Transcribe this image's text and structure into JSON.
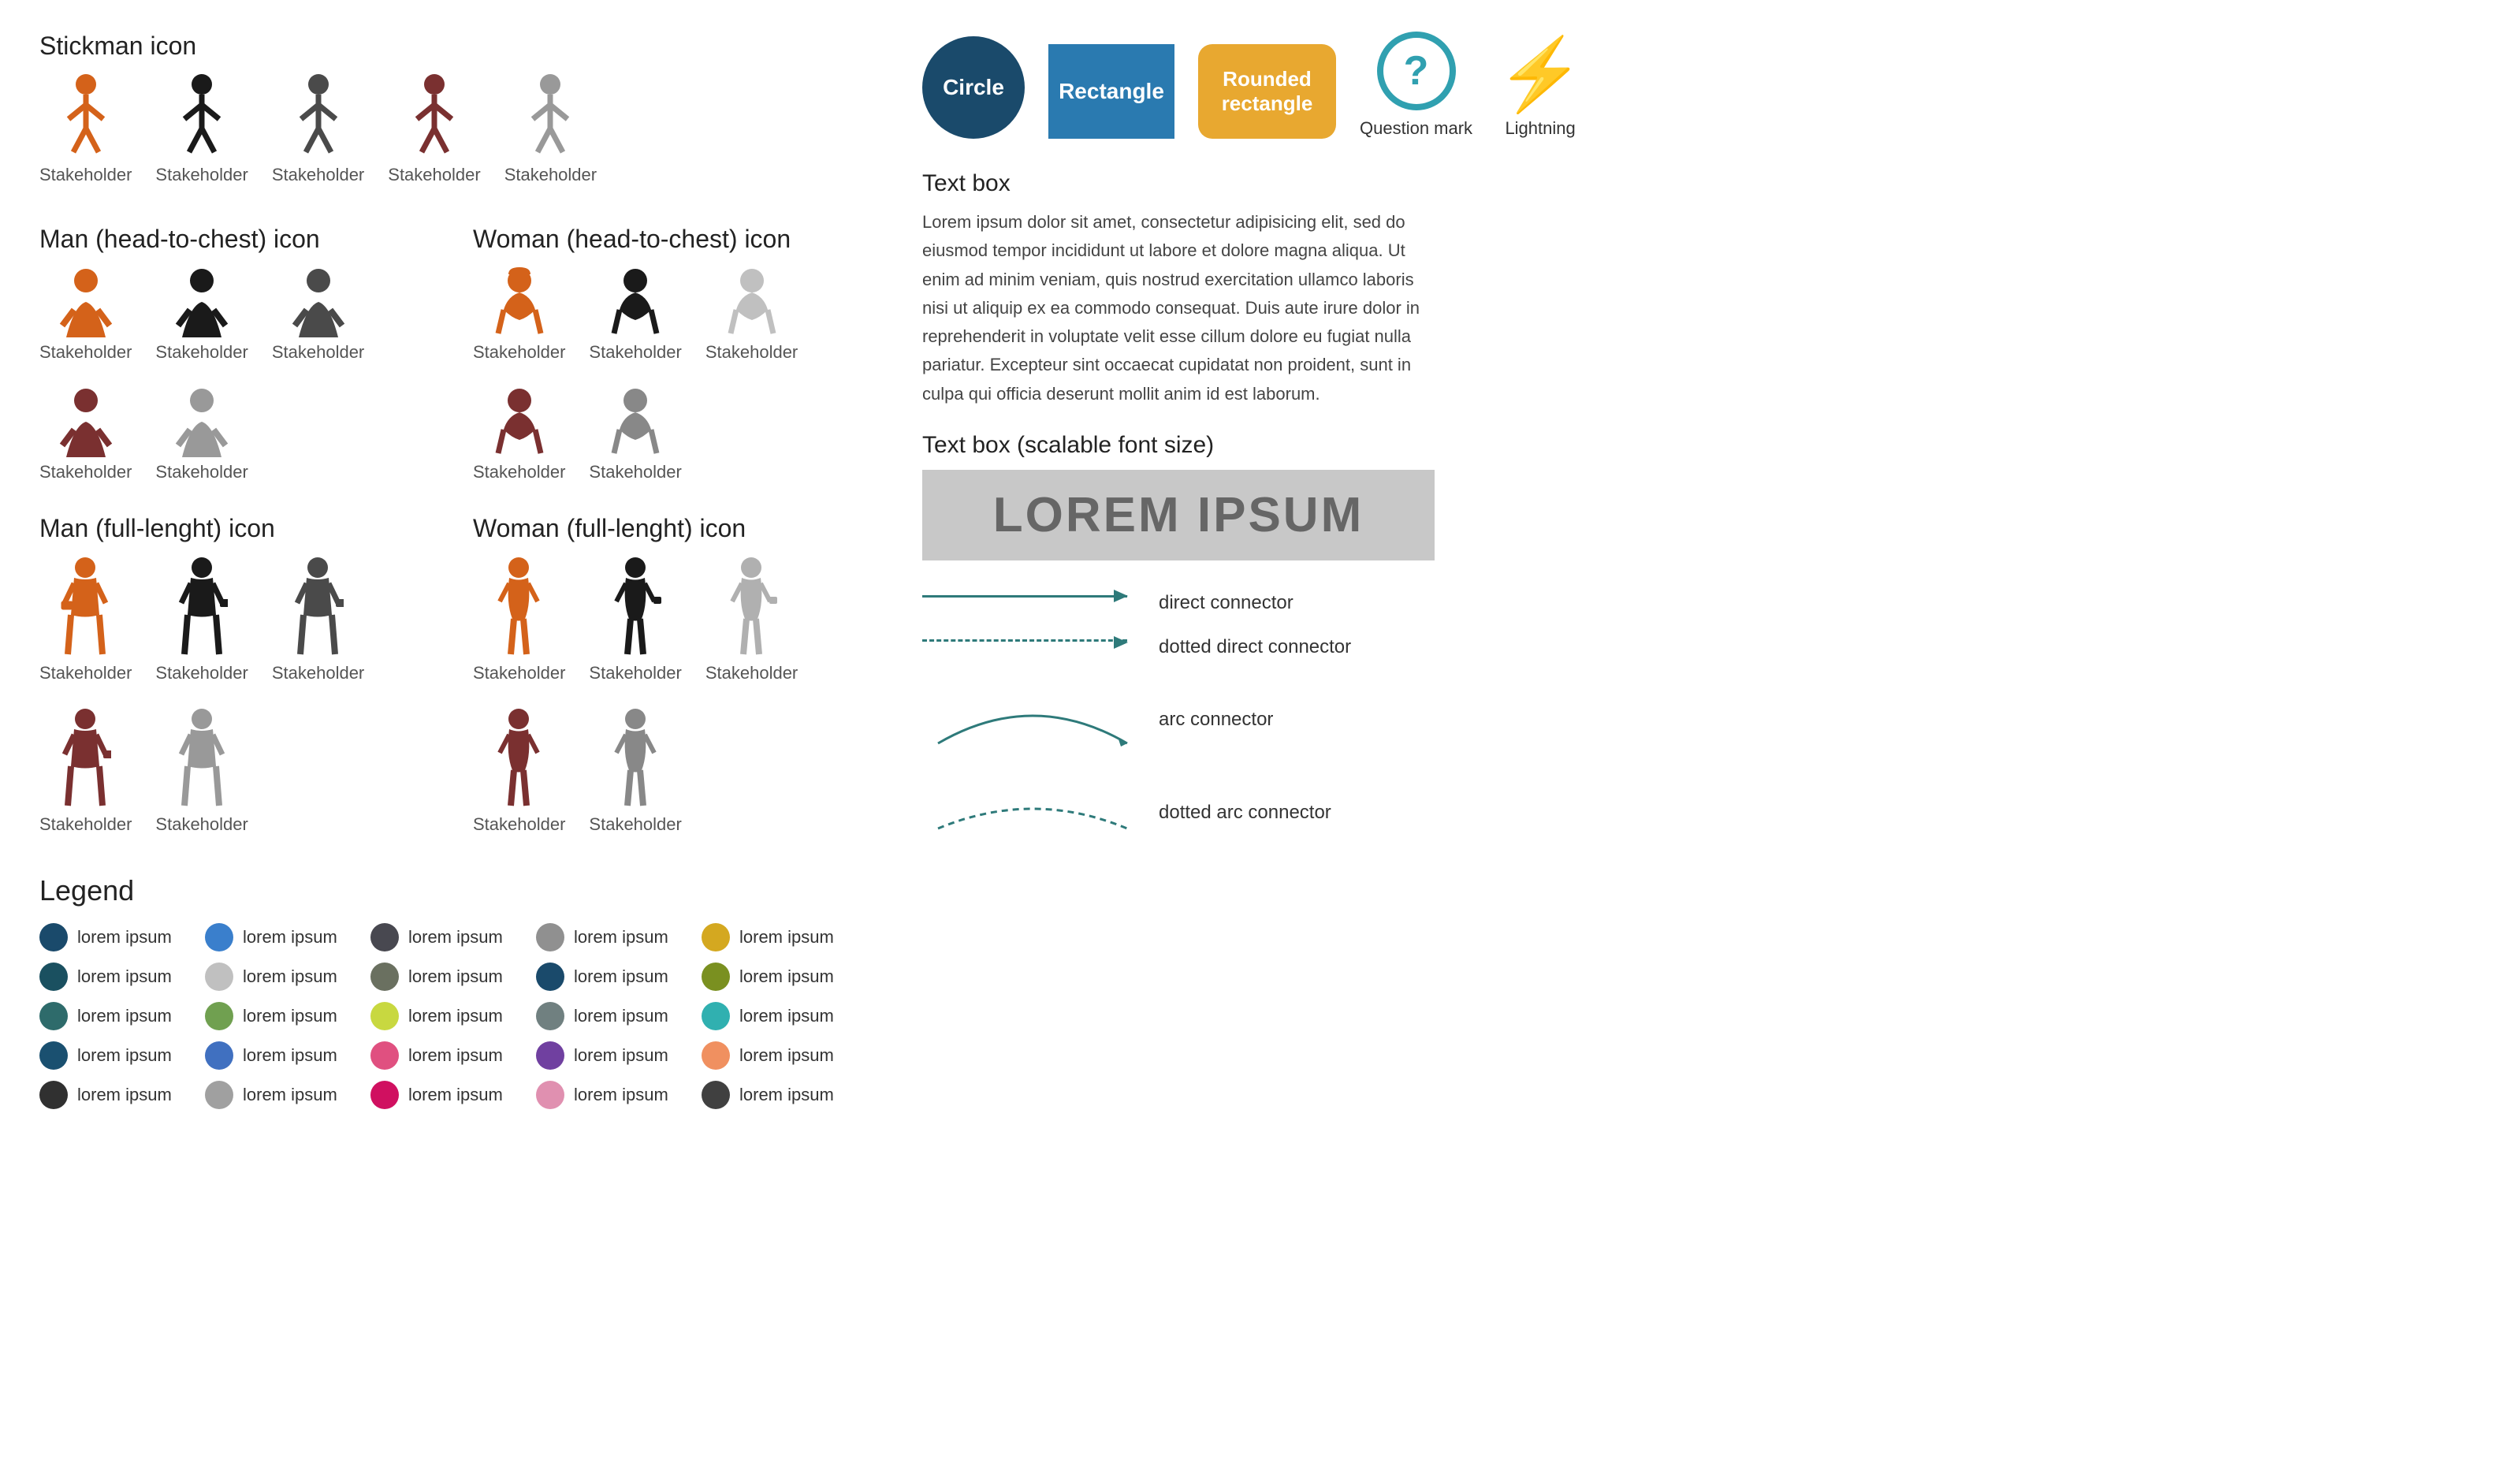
{
  "left": {
    "stickman_title": "Stickman icon",
    "man_bust_title": "Man (head-to-chest) icon",
    "woman_bust_title": "Woman (head-to-chest) icon",
    "man_full_title": "Man (full-lenght) icon",
    "woman_full_title": "Woman (full-lenght) icon",
    "stakeholder_label": "Stakeholder",
    "legend_title": "Legend",
    "legend_items_col1": [
      {
        "color": "#1a4a6b",
        "text": "lorem ipsum"
      },
      {
        "color": "#3a7fcc",
        "text": "lorem ipsum"
      },
      {
        "color": "#404050",
        "text": "lorem ipsum"
      },
      {
        "color": "#909090",
        "text": "lorem ipsum"
      },
      {
        "color": "#d4a820",
        "text": "lorem ipsum"
      }
    ],
    "legend_items_col2": [
      {
        "color": "#1a5060",
        "text": "lorem ipsum"
      },
      {
        "color": "#b0b0b0",
        "text": "lorem ipsum"
      },
      {
        "color": "#6a7060",
        "text": "lorem ipsum"
      },
      {
        "color": "#1a4a6b",
        "text": "lorem ipsum"
      },
      {
        "color": "#7a9020",
        "text": "lorem ipsum"
      }
    ],
    "legend_items_col3": [
      {
        "color": "#2e6b6b",
        "text": "lorem ipsum"
      },
      {
        "color": "#70a050",
        "text": "lorem ipsum"
      },
      {
        "color": "#c0d040",
        "text": "lorem ipsum"
      },
      {
        "color": "#708080",
        "text": "lorem ipsum"
      },
      {
        "color": "#30b0b0",
        "text": "lorem ipsum"
      }
    ],
    "legend_items_col4": [
      {
        "color": "#1a5070",
        "text": "lorem ipsum"
      },
      {
        "color": "#4070c0",
        "text": "lorem ipsum"
      },
      {
        "color": "#e05080",
        "text": "lorem ipsum"
      },
      {
        "color": "#7040a0",
        "text": "lorem ipsum"
      },
      {
        "color": "#f09060",
        "text": "lorem ipsum"
      }
    ],
    "legend_items_col5": [
      {
        "color": "#303030",
        "text": "lorem ipsum"
      },
      {
        "color": "#909090",
        "text": "lorem ipsum"
      },
      {
        "color": "#d01060",
        "text": "lorem ipsum"
      },
      {
        "color": "#e090b0",
        "text": "lorem ipsum"
      },
      {
        "color": "#404040",
        "text": "lorem ipsum"
      }
    ]
  },
  "right": {
    "circle_label": "Circle",
    "rectangle_label": "Rectangle",
    "rounded_rect_label": "Rounded rectangle",
    "question_mark_label": "Question mark",
    "lightning_label": "Lightning",
    "textbox_title": "Text box",
    "textbox_content": "Lorem ipsum dolor sit amet, consectetur adipisicing elit, sed do eiusmod tempor incididunt ut labore et dolore magna aliqua. Ut enim ad minim veniam, quis nostrud exercitation ullamco laboris nisi ut aliquip ex ea commodo consequat. Duis aute irure dolor in reprehenderit in voluptate velit esse cillum dolore eu fugiat nulla pariatur. Excepteur sint occaecat cupidatat non proident, sunt in culpa qui officia deserunt mollit anim id est laborum.",
    "scalable_title": "Text box (scalable font size)",
    "scalable_text": "LOREM IPSUM",
    "direct_connector_label": "direct connector",
    "dotted_direct_label": "dotted direct connector",
    "arc_connector_label": "arc connector",
    "dotted_arc_label": "dotted arc connector"
  }
}
